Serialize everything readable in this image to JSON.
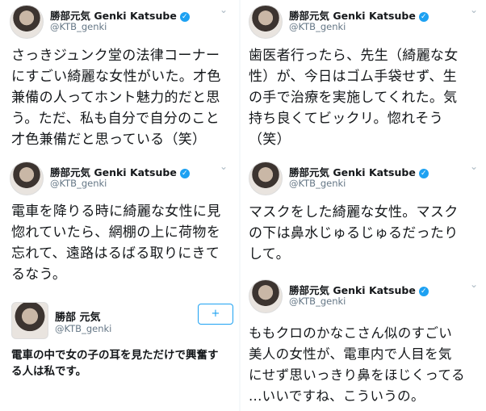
{
  "tweets": [
    {
      "name": "勝部元気 Genki Katsube",
      "handle": "@KTB_genki",
      "text": "さっきジュンク堂の法律コーナー\nにすごい綺麗な女性がいた。才色\n兼備の人ってホント魅力的だと思\nう。ただ、私も自分で自分のこと\n才色兼備だと思っている（笑）"
    },
    {
      "name": "勝部元気 Genki Katsube",
      "handle": "@KTB_genki",
      "text": "電車を降りる時に綺麗な女性に見\n惚れていたら、網棚の上に荷物を\n忘れて、遠路はるばる取りにきて\nるなう。"
    },
    {
      "name": "勝部 元気",
      "handle": "@KTB_genki",
      "text": "電車の中で女の子の耳を見ただけで興奮す\nる人は私です。",
      "follow_icon": "add-user-icon",
      "follow_label": "+"
    },
    {
      "name": "勝部元気 Genki Katsube",
      "handle": "@KTB_genki",
      "text": "歯医者行ったら、先生（綺麗な女\n性）が、今日はゴム手袋せず、生\nの手で治療を実施してくれた。気\n持ち良くてビックリ。惚れそう\n（笑）"
    },
    {
      "name": "勝部元気 Genki Katsube",
      "handle": "@KTB_genki",
      "text": "マスクをした綺麗な女性。マスク\nの下は鼻水じゅるじゅるだったり\nして。"
    },
    {
      "name": "勝部元気 Genki Katsube",
      "handle": "@KTB_genki",
      "text": "ももクロのかなこさん似のすごい\n美人の女性が、電車内で人目を気\nにせず思いっきり鼻をほじくってる\n...いいですね、こういうの。"
    }
  ],
  "icons": {
    "verified": "✓",
    "caret": "⌄"
  },
  "colors": {
    "accent": "#1da1f2",
    "handle": "#657786",
    "text": "#14171a"
  }
}
